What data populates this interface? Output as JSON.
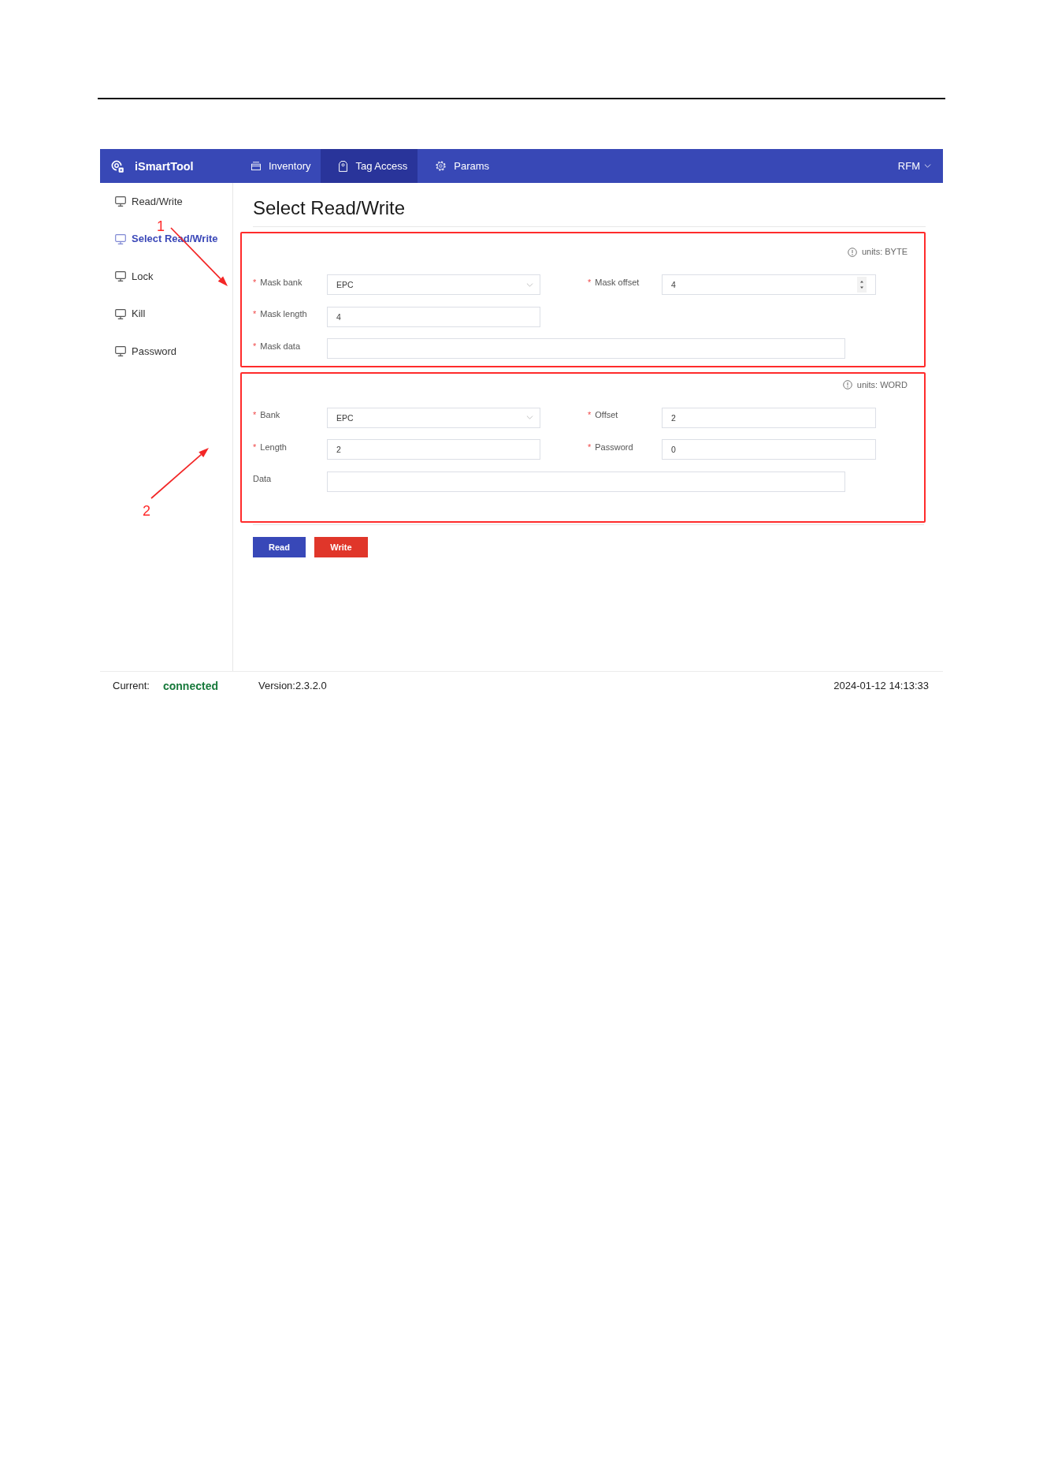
{
  "app": {
    "name": "iSmartTool"
  },
  "nav": {
    "tabs": [
      {
        "label": "Inventory",
        "selected": false
      },
      {
        "label": "Tag Access",
        "selected": true
      },
      {
        "label": "Params",
        "selected": false
      }
    ],
    "user_menu": "RFM"
  },
  "sidebar": {
    "items": [
      {
        "label": "Read/Write",
        "selected": false
      },
      {
        "label": "Select Read/Write",
        "selected": true
      },
      {
        "label": "Lock",
        "selected": false
      },
      {
        "label": "Kill",
        "selected": false
      },
      {
        "label": "Password",
        "selected": false
      }
    ]
  },
  "page_title": "Select Read/Write",
  "sections": [
    {
      "highlighted": true,
      "note": "units: BYTE",
      "rows": [
        {
          "fields": [
            {
              "kind": "select",
              "mark": "*",
              "label": "Mask bank",
              "value": "EPC"
            },
            {
              "kind": "spinner",
              "mark": "*",
              "label": "Mask offset",
              "value": "4"
            }
          ]
        },
        {
          "fields": [
            {
              "kind": "input",
              "mark": "*",
              "label": "Mask length",
              "value": "4"
            }
          ]
        },
        {
          "fields": [
            {
              "kind": "wide",
              "mark": "*",
              "label": "Mask data"
            }
          ]
        }
      ]
    },
    {
      "highlighted": true,
      "note": "units: WORD",
      "rows": [
        {
          "fields": [
            {
              "kind": "select",
              "mark": "*",
              "label": "Bank",
              "value": "EPC"
            },
            {
              "kind": "input",
              "mark": "*",
              "label": "Offset",
              "value": "2"
            }
          ]
        },
        {
          "fields": [
            {
              "kind": "input",
              "mark": "*",
              "label": "Length",
              "value": "2"
            },
            {
              "kind": "input",
              "mark": "*",
              "label": "Password",
              "value": "0"
            }
          ]
        },
        {
          "fields": [
            {
              "kind": "wide",
              "label": "Data"
            }
          ]
        }
      ]
    }
  ],
  "buttons": [
    {
      "label": "Read",
      "kind": "primary"
    },
    {
      "label": "Write",
      "kind": "danger"
    }
  ],
  "callouts": [
    {
      "label": "1"
    },
    {
      "label": "2"
    }
  ],
  "status_bar": {
    "label": "Current:",
    "connection": "connected",
    "version": "Version:2.3.2.0",
    "datetime": "2024-01-12 14:13:33"
  }
}
